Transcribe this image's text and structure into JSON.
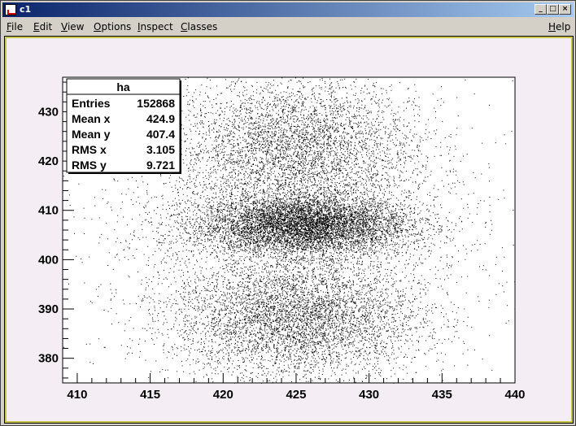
{
  "window": {
    "title": "c1",
    "controls": {
      "minimize": "_",
      "maximize": "□",
      "close": "×"
    }
  },
  "menubar": {
    "items": [
      {
        "id": "file",
        "first": "F",
        "rest": "ile"
      },
      {
        "id": "edit",
        "first": "E",
        "rest": "dit"
      },
      {
        "id": "view",
        "first": "V",
        "rest": "iew"
      },
      {
        "id": "options",
        "first": "O",
        "rest": "ptions"
      },
      {
        "id": "inspect",
        "first": "I",
        "rest": "nspect"
      },
      {
        "id": "classes",
        "first": "C",
        "rest": "lasses"
      }
    ],
    "help": {
      "first": "H",
      "rest": "elp"
    }
  },
  "colors": {
    "canvas_bg": "#f4eef4",
    "plot_bg": "#ffffff",
    "marker": "#000000",
    "canvas_border": "#c6c44a"
  },
  "stats_box": {
    "title": "ha",
    "rows": [
      {
        "label": "Entries",
        "value": "152868"
      },
      {
        "label": "Mean x",
        "value": "424.9"
      },
      {
        "label": "Mean y",
        "value": "407.4"
      },
      {
        "label": "RMS x",
        "value": "3.105"
      },
      {
        "label": "RMS y",
        "value": "9.721"
      }
    ]
  },
  "chart_data": {
    "type": "scatter",
    "title": "",
    "xlabel": "",
    "ylabel": "",
    "xlim": [
      409,
      440
    ],
    "ylim": [
      375,
      437
    ],
    "xticks": [
      410,
      415,
      420,
      425,
      430,
      435,
      440
    ],
    "yticks": [
      380,
      390,
      400,
      410,
      420,
      430
    ],
    "grid": false,
    "legend": "top-left statistics box",
    "entries": 152868,
    "mean_x": 424.9,
    "mean_y": 407.4,
    "rms_x": 3.105,
    "rms_y": 9.721,
    "density_clusters": [
      {
        "x": 425.5,
        "y": 407,
        "sx": 3.6,
        "sy": 3.0,
        "weight": 1.0
      },
      {
        "x": 425.0,
        "y": 423,
        "sx": 4.0,
        "sy": 7.0,
        "weight": 0.28
      },
      {
        "x": 425.0,
        "y": 388,
        "sx": 4.2,
        "sy": 6.0,
        "weight": 0.35
      },
      {
        "x": 424.5,
        "y": 407,
        "sx": 6.5,
        "sy": 14.0,
        "weight": 0.22
      }
    ]
  }
}
